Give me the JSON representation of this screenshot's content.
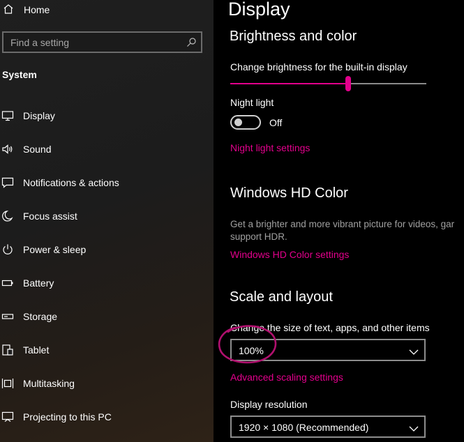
{
  "colors": {
    "accent": "#e3008c",
    "sidebar_bg": "#1f1f1f",
    "main_bg": "#000000"
  },
  "sidebar": {
    "home_label": "Home",
    "search_placeholder": "Find a setting",
    "section_title": "System",
    "items": [
      {
        "label": "Display",
        "icon": "monitor-icon"
      },
      {
        "label": "Sound",
        "icon": "speaker-icon"
      },
      {
        "label": "Notifications & actions",
        "icon": "notification-icon"
      },
      {
        "label": "Focus assist",
        "icon": "moon-icon"
      },
      {
        "label": "Power & sleep",
        "icon": "power-icon"
      },
      {
        "label": "Battery",
        "icon": "battery-icon"
      },
      {
        "label": "Storage",
        "icon": "storage-icon"
      },
      {
        "label": "Tablet",
        "icon": "tablet-icon"
      },
      {
        "label": "Multitasking",
        "icon": "multitasking-icon"
      },
      {
        "label": "Projecting to this PC",
        "icon": "projecting-icon"
      }
    ]
  },
  "main": {
    "title": "Display",
    "brightness_section": {
      "heading": "Brightness and color",
      "slider_label": "Change brightness for the built-in display",
      "brightness_fraction": 0.6,
      "night_light_label": "Night light",
      "night_light_state": "Off",
      "night_light_link": "Night light settings"
    },
    "hd_color_section": {
      "heading": "Windows HD Color",
      "description_line1": "Get a brighter and more vibrant picture for videos, gar",
      "description_line2": "support HDR.",
      "link": "Windows HD Color settings"
    },
    "scale_section": {
      "heading": "Scale and layout",
      "scale_label": "Change the size of text, apps, and other items",
      "scale_value": "100%",
      "advanced_link": "Advanced scaling settings",
      "resolution_label": "Display resolution",
      "resolution_value": "1920 × 1080 (Recommended)"
    }
  }
}
